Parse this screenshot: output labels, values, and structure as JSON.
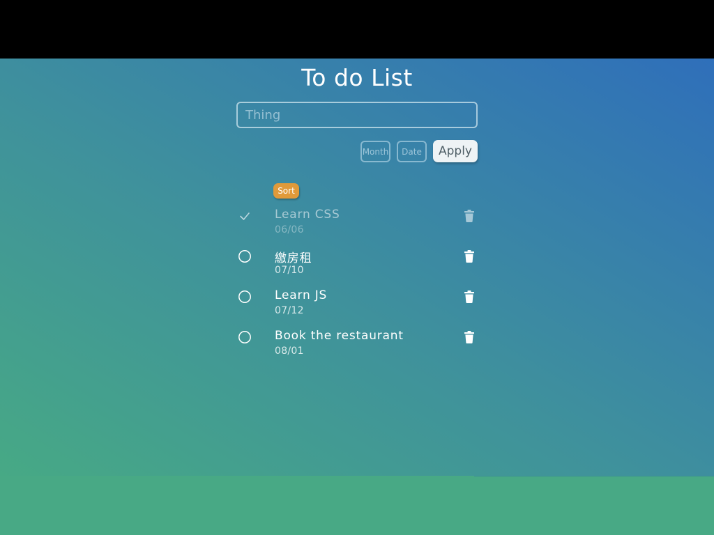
{
  "header": {
    "title": "To do List"
  },
  "form": {
    "thing_placeholder": "Thing",
    "month_placeholder": "Month",
    "date_placeholder": "Date",
    "apply_label": "Apply"
  },
  "sort": {
    "label": "Sort"
  },
  "todos": [
    {
      "text": "Learn CSS",
      "date": "06/06",
      "done": true
    },
    {
      "text": "繳房租",
      "date": "07/10",
      "done": false
    },
    {
      "text": "Learn JS",
      "date": "07/12",
      "done": false
    },
    {
      "text": "Book the restaurant",
      "date": "08/01",
      "done": false
    }
  ],
  "icons": {
    "done": "check-icon",
    "pending": "circle-icon",
    "delete": "trash-icon"
  },
  "colors": {
    "sort_button": "#e09a3a",
    "apply_button": "#eef3f5",
    "top_bar": "#000000",
    "bottom_background": "#48a985",
    "gradient_top_right": "#2f6fba",
    "gradient_bottom_left": "#47a985"
  }
}
